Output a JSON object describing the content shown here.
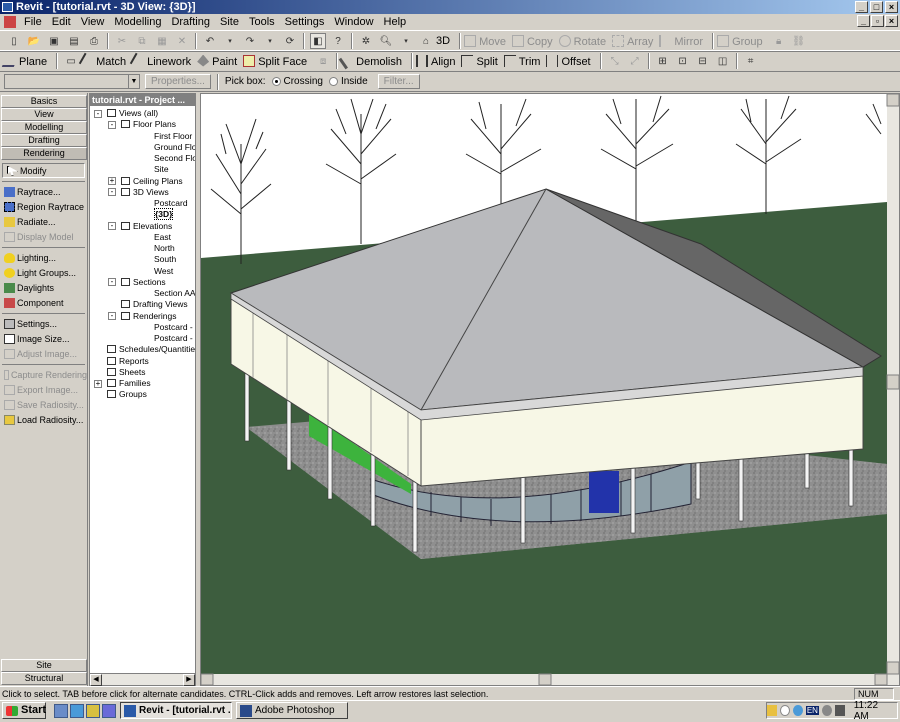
{
  "window": {
    "title": "Revit - [tutorial.rvt - 3D View: {3D}]"
  },
  "menu": [
    "File",
    "Edit",
    "View",
    "Modelling",
    "Drafting",
    "Site",
    "Tools",
    "Settings",
    "Window",
    "Help"
  ],
  "toolbar1": {
    "view3d_label": "3D",
    "edit_tools": [
      "Move",
      "Copy",
      "Rotate",
      "Array",
      "Mirror"
    ],
    "group_label": "Group"
  },
  "toolbar2": [
    "Plane",
    "Match",
    "Linework",
    "Paint",
    "Split Face",
    "Demolish",
    "Align",
    "Split",
    "Trim",
    "Offset"
  ],
  "options_bar": {
    "properties_label": "Properties...",
    "pick_box_label": "Pick box:",
    "crossing_label": "Crossing",
    "inside_label": "Inside",
    "filter_label": "Filter..."
  },
  "design_bar": {
    "tabs": [
      "Basics",
      "View",
      "Modelling",
      "Drafting",
      "Rendering"
    ],
    "modify_label": "Modify",
    "items": [
      {
        "label": "Raytrace...",
        "enabled": true,
        "icon": "raytrace-icon"
      },
      {
        "label": "Region Raytrace",
        "enabled": true,
        "icon": "region-raytrace-icon"
      },
      {
        "label": "Radiate...",
        "enabled": true,
        "icon": "radiate-icon"
      },
      {
        "label": "Display Model",
        "enabled": false,
        "icon": "display-model-icon"
      },
      {
        "label": "Lighting...",
        "enabled": true,
        "icon": "lightbulb-icon"
      },
      {
        "label": "Light Groups...",
        "enabled": true,
        "icon": "light-groups-icon"
      },
      {
        "label": "Daylights",
        "enabled": true,
        "icon": "sun-icon"
      },
      {
        "label": "Component",
        "enabled": true,
        "icon": "component-icon"
      },
      {
        "label": "Settings...",
        "enabled": true,
        "icon": "settings-icon"
      },
      {
        "label": "Image Size...",
        "enabled": true,
        "icon": "image-size-icon"
      },
      {
        "label": "Adjust Image...",
        "enabled": false,
        "icon": "adjust-image-icon"
      },
      {
        "label": "Capture Rendering",
        "enabled": false,
        "icon": "capture-icon"
      },
      {
        "label": "Export Image...",
        "enabled": false,
        "icon": "export-icon"
      },
      {
        "label": "Save Radiosity...",
        "enabled": false,
        "icon": "save-icon"
      },
      {
        "label": "Load Radiosity...",
        "enabled": true,
        "icon": "load-icon"
      }
    ],
    "bottom_tabs": [
      "Site",
      "Structural"
    ]
  },
  "project_browser": {
    "title": "tutorial.rvt - Project ...",
    "tree": [
      {
        "label": "Views (all)",
        "level": 0,
        "toggle": "-"
      },
      {
        "label": "Floor Plans",
        "level": 1,
        "toggle": "-"
      },
      {
        "label": "First Floor",
        "level": 2
      },
      {
        "label": "Ground Floor",
        "level": 2
      },
      {
        "label": "Second Floor",
        "level": 2
      },
      {
        "label": "Site",
        "level": 2
      },
      {
        "label": "Ceiling Plans",
        "level": 1,
        "toggle": "+"
      },
      {
        "label": "3D Views",
        "level": 1,
        "toggle": "-"
      },
      {
        "label": "Postcard",
        "level": 2
      },
      {
        "label": "{3D}",
        "level": 2,
        "selected": true
      },
      {
        "label": "Elevations",
        "level": 1,
        "toggle": "-"
      },
      {
        "label": "East",
        "level": 2
      },
      {
        "label": "North",
        "level": 2
      },
      {
        "label": "South",
        "level": 2
      },
      {
        "label": "West",
        "level": 2
      },
      {
        "label": "Sections",
        "level": 1,
        "toggle": "-"
      },
      {
        "label": "Section AA",
        "level": 2
      },
      {
        "label": "Drafting Views",
        "level": 1
      },
      {
        "label": "Renderings",
        "level": 1,
        "toggle": "-"
      },
      {
        "label": "Postcard - Grou",
        "level": 2
      },
      {
        "label": "Postcard - Wall",
        "level": 2
      },
      {
        "label": "Schedules/Quantitie",
        "level": 0
      },
      {
        "label": "Reports",
        "level": 0
      },
      {
        "label": "Sheets",
        "level": 0
      },
      {
        "label": "Families",
        "level": 0,
        "toggle": "+"
      },
      {
        "label": "Groups",
        "level": 0
      }
    ]
  },
  "status": {
    "message": "Click to select. TAB before click for alternate candidates. CTRL-Click adds and removes. Left arrow restores last selection.",
    "num_indicator": "NUM"
  },
  "taskbar": {
    "start_label": "Start",
    "tasks": [
      {
        "label": "Revit - [tutorial.rvt ...",
        "active": true
      },
      {
        "label": "Adobe Photoshop",
        "active": false
      }
    ],
    "lang": "EN",
    "time": "11:22 AM"
  },
  "colors": {
    "ground": "#3d5d3e",
    "roof": "#b9babd",
    "gravel": "#8c8c8c",
    "walls": "#f7f7e6",
    "green_panel": "#3db33d",
    "blue_door": "#2233aa",
    "title_gradient_start": "#0a246a"
  }
}
